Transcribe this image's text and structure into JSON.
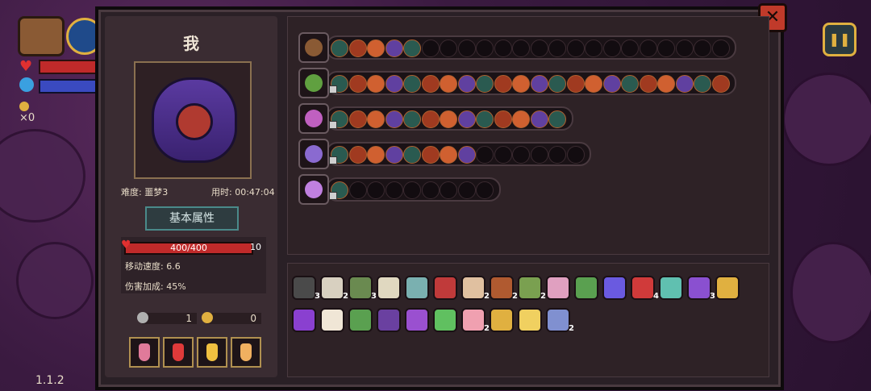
{
  "hud": {
    "coins": "×0",
    "version": "1.1.2",
    "pause_icon": "pause-icon"
  },
  "character": {
    "name": "我",
    "difficulty": "难度: 噩梦3",
    "time": "用时: 00:47:04"
  },
  "attributes": {
    "tab_label": "基本属性",
    "hp_text": "400/400",
    "hp_fraction": 1.0,
    "shield": "10",
    "move_speed": "移动速度: 6.6",
    "damage_bonus": "伤害加成: 45%"
  },
  "resources": {
    "keys": "1",
    "coins": "0"
  },
  "potions": [
    {
      "name": "pink-potion-icon",
      "color": "#e07a9a"
    },
    {
      "name": "red-potion-icon",
      "color": "#e03a3a"
    },
    {
      "name": "yellow-potion-icon",
      "color": "#f0c040"
    },
    {
      "name": "orange-potion-icon",
      "color": "#f0b060"
    }
  ],
  "wand_rows": [
    {
      "icon": "chest-icon",
      "icon_color": "#8a5a34",
      "filled": 5,
      "total": 22,
      "locked": false
    },
    {
      "icon": "green-staff-icon",
      "icon_color": "#60a040",
      "filled": 22,
      "total": 22,
      "locked": true
    },
    {
      "icon": "pink-staff-icon",
      "icon_color": "#c060c0",
      "filled": 13,
      "total": 13,
      "locked": true
    },
    {
      "icon": "purple-staff-icon",
      "icon_color": "#8a6ad0",
      "filled": 8,
      "total": 14,
      "locked": true
    },
    {
      "icon": "crystal-staff-icon",
      "icon_color": "#c080e0",
      "filled": 1,
      "total": 9,
      "locked": true
    }
  ],
  "relics": {
    "row1": [
      {
        "name": "hat-relic-icon",
        "color": "#4a4a4a",
        "count": "3"
      },
      {
        "name": "ribcage-relic-icon",
        "color": "#d8d0c0",
        "count": "2"
      },
      {
        "name": "sword-relic-icon",
        "color": "#6a8a50",
        "count": "3"
      },
      {
        "name": "teeth-relic-icon",
        "color": "#e0d8c0",
        "count": ""
      },
      {
        "name": "compass-relic-icon",
        "color": "#7ab0b0",
        "count": ""
      },
      {
        "name": "eye-relic-icon",
        "color": "#c03a3a",
        "count": ""
      },
      {
        "name": "bone-relic-icon",
        "color": "#e0c0a0",
        "count": "2"
      },
      {
        "name": "crate-relic-icon",
        "color": "#b05a30",
        "count": "2"
      },
      {
        "name": "worm-relic-icon",
        "color": "#7aa050",
        "count": "2"
      },
      {
        "name": "brain-relic-icon",
        "color": "#e0a0c0",
        "count": ""
      },
      {
        "name": "slime-relic-icon",
        "color": "#5aa050",
        "count": ""
      },
      {
        "name": "flask-relic-icon",
        "color": "#6a5ae0",
        "count": ""
      },
      {
        "name": "demon-relic-icon",
        "color": "#d03a3a",
        "count": "4"
      },
      {
        "name": "gem-relic-icon",
        "color": "#60c0b0",
        "count": ""
      },
      {
        "name": "witch-hat-relic-icon",
        "color": "#8a50d0",
        "count": "3"
      },
      {
        "name": "gauntlet-relic-icon",
        "color": "#e0b040",
        "count": ""
      }
    ],
    "row2": [
      {
        "name": "cape-relic-icon",
        "color": "#8a40d0",
        "count": ""
      },
      {
        "name": "wings-relic-icon",
        "color": "#f0e6d6",
        "count": ""
      },
      {
        "name": "leaf-relic-icon",
        "color": "#5aa050",
        "count": ""
      },
      {
        "name": "book-relic-icon",
        "color": "#6a40a0",
        "count": ""
      },
      {
        "name": "boot-relic-icon",
        "color": "#9a50d0",
        "count": ""
      },
      {
        "name": "syringe-relic-icon",
        "color": "#60c060",
        "count": ""
      },
      {
        "name": "feather-relic-icon",
        "color": "#f0a0b0",
        "count": "2"
      },
      {
        "name": "bell-relic-icon",
        "color": "#e0b040",
        "count": ""
      },
      {
        "name": "candy-relic-icon",
        "color": "#f0d060",
        "count": ""
      },
      {
        "name": "crystal-relic-icon",
        "color": "#8090d0",
        "count": "2"
      }
    ]
  },
  "close_icon": "close-icon"
}
